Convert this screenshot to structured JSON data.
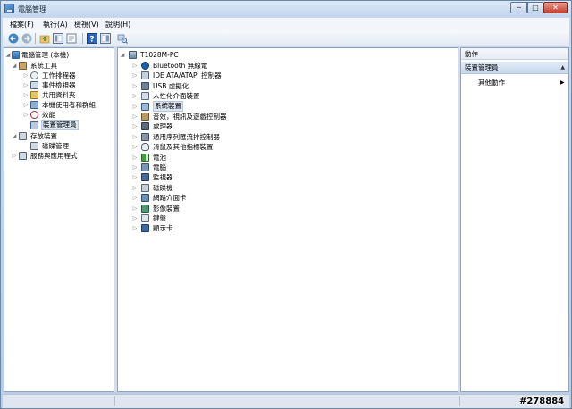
{
  "window": {
    "title": "電腦管理",
    "minimize_glyph": "─",
    "maximize_glyph": "□",
    "close_glyph": "✕"
  },
  "menu": [
    "檔案(F)",
    "執行(A)",
    "檢視(V)",
    "說明(H)"
  ],
  "toolbar_icons": [
    "back-arrow-icon",
    "forward-arrow-icon",
    "up-folder-icon",
    "show-hide-tree-icon",
    "properties-icon",
    "help-icon",
    "show-hide-action-pane-icon",
    "scan-hardware-icon"
  ],
  "left_tree": {
    "root": "電腦管理 (本機)",
    "system_tools": "系統工具",
    "system_tools_items": [
      "工作排程器",
      "事件檢視器",
      "共用資料夾",
      "本機使用者和群組",
      "效能",
      "裝置管理員"
    ],
    "storage": "存放裝置",
    "storage_items": [
      "磁碟管理"
    ],
    "services": "服務與應用程式"
  },
  "center_tree": {
    "root": "T1028M-PC",
    "categories": [
      "Bluetooth 無線電",
      "IDE ATA/ATAPI 控制器",
      "USB 虛擬化",
      "人性化介面裝置",
      "系統裝置",
      "音效，視訊及遊戲控制器",
      "處理器",
      "通用序列匯流排控制器",
      "滑鼠及其他指標裝置",
      "電池",
      "電腦",
      "監視器",
      "磁碟機",
      "網路介面卡",
      "影像裝置",
      "鍵盤",
      "顯示卡"
    ],
    "selected_index": 4
  },
  "actions": {
    "header": "動作",
    "section": "裝置管理員",
    "collapse_glyph": "▲",
    "more": "其他動作",
    "more_arrow": "▶"
  },
  "watermark": "#278884",
  "colors": {
    "selection_fill": "#dde6f3",
    "section_header": "#c8d8ee",
    "close_button": "#c2402e"
  }
}
